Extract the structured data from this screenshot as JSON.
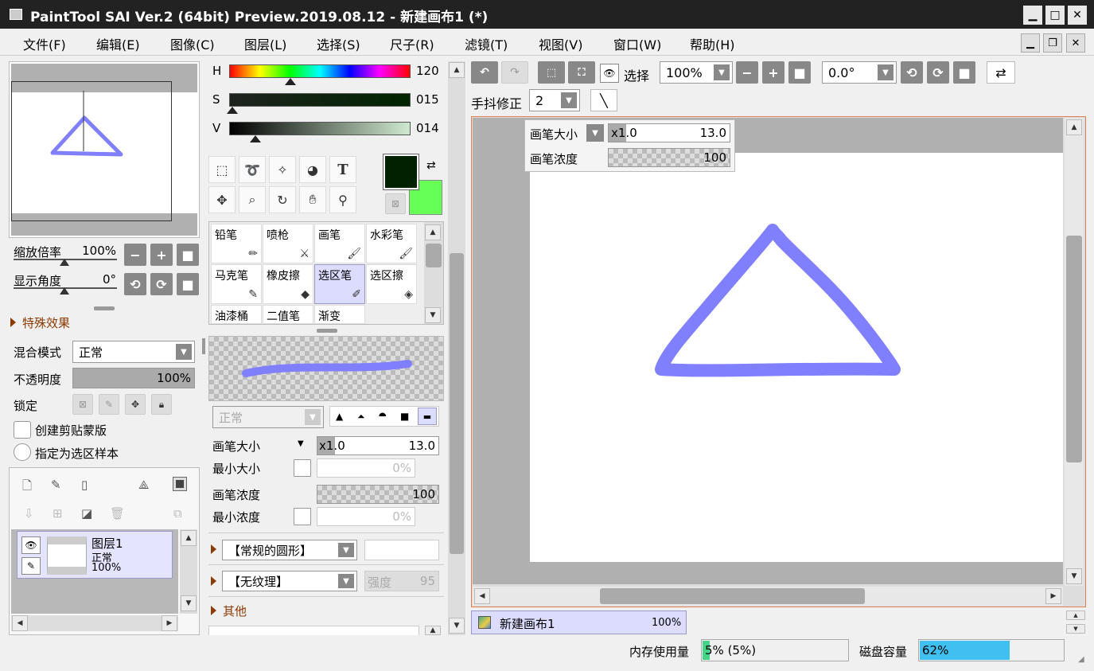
{
  "app": {
    "title": "PaintTool SAI Ver.2 (64bit) Preview.2019.08.12 - 新建画布1 (*)"
  },
  "menu": [
    "文件(F)",
    "编辑(E)",
    "图像(C)",
    "图层(L)",
    "选择(S)",
    "尺子(R)",
    "滤镜(T)",
    "视图(V)",
    "窗口(W)",
    "帮助(H)"
  ],
  "navigator": {
    "zoom_label": "缩放倍率",
    "zoom_value": "100%",
    "angle_label": "显示角度",
    "angle_value": "0°"
  },
  "effects": {
    "label": "特殊效果"
  },
  "layer_props": {
    "blend_label": "混合模式",
    "blend_value": "正常",
    "opacity_label": "不透明度",
    "opacity_value": "100%",
    "lock_label": "锁定",
    "clip_label": "创建剪贴蒙版",
    "sample_label": "指定为选区样本"
  },
  "layers": [
    {
      "name": "图层1",
      "mode": "正常",
      "opacity": "100%"
    }
  ],
  "color": {
    "h_label": "H",
    "h_value": "120",
    "s_label": "S",
    "s_value": "015",
    "v_label": "V",
    "v_value": "014",
    "primary": "#002200",
    "secondary": "#66ff55"
  },
  "tools": {
    "text_tool": "T"
  },
  "brushes": [
    "铅笔",
    "喷枪",
    "画笔",
    "水彩笔",
    "马克笔",
    "橡皮擦",
    "选区笔",
    "选区擦",
    "油漆桶",
    "二值笔",
    "渐变"
  ],
  "brush_settings": {
    "blend_value": "正常",
    "size_label": "画笔大小",
    "size_mult": "x1.0",
    "size_value": "13.0",
    "min_size_label": "最小大小",
    "min_size_value": "0%",
    "density_label": "画笔浓度",
    "density_value": "100",
    "min_density_label": "最小浓度",
    "min_density_value": "0%",
    "shape_value": "【常规的圆形】",
    "texture_value": "【无纹理】",
    "strength_label": "强度",
    "strength_value": "95",
    "other_label": "其他"
  },
  "toolbar": {
    "select_label": "选择",
    "zoom_value": "100%",
    "angle_value": "0.0°",
    "stabilizer_label": "手抖修正",
    "stabilizer_value": "2"
  },
  "overlay": {
    "size_label": "画笔大小",
    "size_mult": "x1.0",
    "size_value": "13.0",
    "density_label": "画笔浓度",
    "density_value": "100"
  },
  "canvas_tab": {
    "name": "新建画布1",
    "zoom": "100%"
  },
  "status": {
    "memory_label": "内存使用量",
    "memory_value": "5% (5%)",
    "memory_fraction": 0.05,
    "disk_label": "磁盘容量",
    "disk_value": "62%",
    "disk_fraction": 0.62
  },
  "stroke_color": "#8080ff"
}
